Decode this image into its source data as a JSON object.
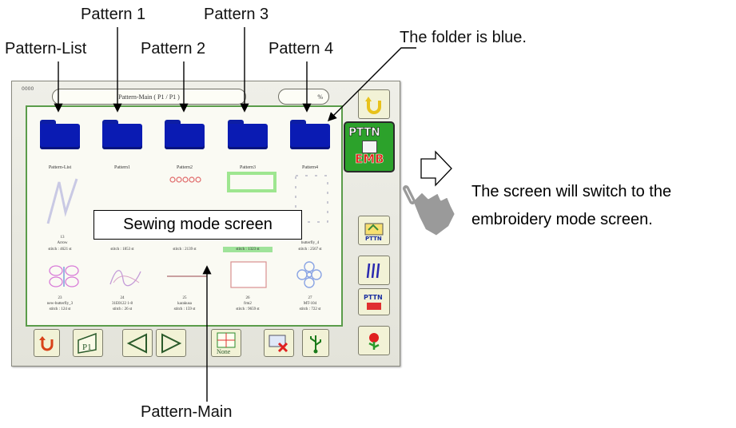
{
  "callouts": {
    "pattern_list": "Pattern-List",
    "pattern_1": "Pattern 1",
    "pattern_2": "Pattern 2",
    "pattern_3": "Pattern 3",
    "pattern_4": "Pattern 4",
    "folder_blue": "The folder is blue.",
    "sewing_mode": "Sewing mode screen",
    "pattern_main": "Pattern-Main",
    "switch_line1": "The screen will switch to the",
    "switch_line2": "embroidery mode screen."
  },
  "screen": {
    "version": "0000",
    "title": "Pattern-Main ( P1 / P1 )",
    "percent": "%",
    "folders": [
      {
        "label": "Pattern-List"
      },
      {
        "label": "Pattern1"
      },
      {
        "label": "Pattern2"
      },
      {
        "label": "Pattern3"
      },
      {
        "label": "Pattern4"
      }
    ],
    "row2": [
      {
        "num": "13",
        "name": "Arrow",
        "stitch": "stitch : 4621 st"
      },
      {
        "num": "",
        "name": "",
        "stitch": "stitch : 1853 st"
      },
      {
        "num": "",
        "name": "",
        "stitch": "stitch : 2139 st"
      },
      {
        "num": "",
        "name": "",
        "stitch": "stitch : 1323 st"
      },
      {
        "num": "",
        "name": "butterfly_4",
        "stitch": "stitch : 2567 st"
      }
    ],
    "row3": [
      {
        "num": "23",
        "name": "new-butterfly_3",
        "stitch": "stitch : 124 st"
      },
      {
        "num": "24",
        "name": "31E0122 1-8",
        "stitch": "stitch : 26 st"
      },
      {
        "num": "25",
        "name": "karakusa",
        "stitch": "stitch : 159 st"
      },
      {
        "num": "26",
        "name": "frm2",
        "stitch": "stitch : 9659 st"
      },
      {
        "num": "27",
        "name": "MT-104",
        "stitch": "stitch : 722 st"
      }
    ],
    "buttons": {
      "pttn": "PTTN",
      "emb": "EMB",
      "p1": "P1",
      "none": "None",
      "pttn_small": "PTTN"
    },
    "colors": {
      "folder": "#0a1bb3",
      "panel_border": "#5a9c4a",
      "pttn_button": "#2ca22b"
    }
  }
}
